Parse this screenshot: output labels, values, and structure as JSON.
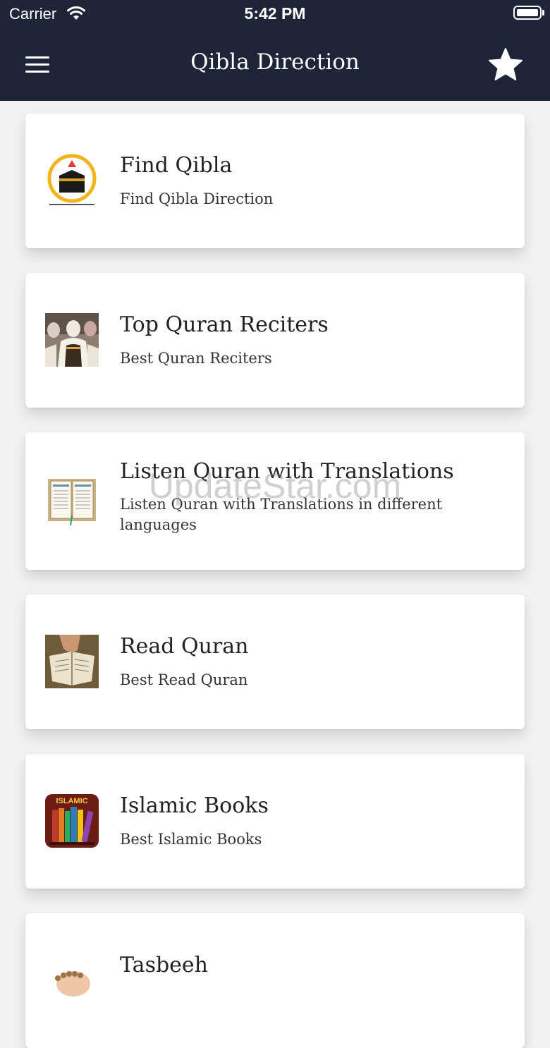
{
  "status_bar": {
    "carrier": "Carrier",
    "time": "5:42 PM"
  },
  "header": {
    "title": "Qibla Direction",
    "menu_icon": "hamburger-icon",
    "star_icon": "star-icon"
  },
  "items": [
    {
      "title": "Find Qibla",
      "subtitle": "Find Qibla Direction",
      "icon": "kaaba-compass-icon"
    },
    {
      "title": "Top Quran Reciters",
      "subtitle": "Best Quran Reciters",
      "icon": "reciter-photo"
    },
    {
      "title": "Listen Quran with Translations",
      "subtitle": "Listen Quran with Translations in different languages",
      "icon": "open-quran-icon"
    },
    {
      "title": "Read Quran",
      "subtitle": "Best Read Quran",
      "icon": "reading-quran-photo"
    },
    {
      "title": "Islamic Books",
      "subtitle": "Best Islamic Books",
      "icon": "islamic-books-icon",
      "icon_label": "ISLAMIC"
    },
    {
      "title": "Tasbeeh",
      "subtitle": "",
      "icon": "tasbeeh-icon"
    }
  ],
  "watermark": "UpdateStar.com",
  "colors": {
    "header_bg": "#1e2538",
    "page_bg": "#f2f2f2",
    "card_bg": "#ffffff",
    "text": "#222222"
  }
}
